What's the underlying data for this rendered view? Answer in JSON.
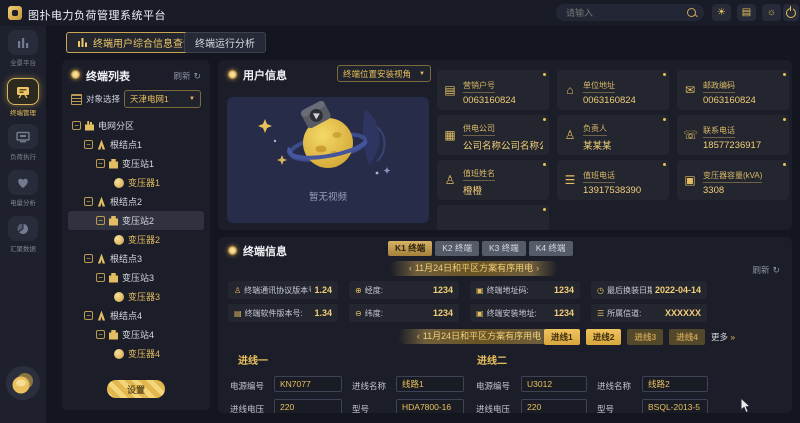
{
  "colors": {
    "accent": "#e9c05c",
    "accent_bright": "#f2cf78",
    "panel_bg": "#1b1d28",
    "card_bg": "#23252f"
  },
  "glyphs": {
    "caret": "▼",
    "collapse": "−",
    "refresh": "↻",
    "weather": "☀",
    "panels": "▤",
    "bulb": "☼",
    "more_arrow": "»",
    "banner_left": "‹",
    "banner_right": "›"
  },
  "topbar": {
    "title": "图扑电力负荷管理系统平台",
    "search_placeholder": "请输入"
  },
  "tabs": {
    "items": [
      {
        "label": "终端用户综合信息查询",
        "active": true
      },
      {
        "label": "终端运行分析",
        "active": false
      }
    ]
  },
  "sidebar": {
    "items": [
      {
        "label": "全景平台",
        "active": false
      },
      {
        "label": "终端管理",
        "active": true
      },
      {
        "label": "负荷执行",
        "active": false
      },
      {
        "label": "电量分析",
        "active": false
      },
      {
        "label": "汇聚数据",
        "active": false
      }
    ]
  },
  "terminal_list": {
    "title": "终端列表",
    "refresh_label": "刷新",
    "object_select_label": "对象选择",
    "object_select_value": "天津电网1",
    "confirm_button": "设置",
    "tree": [
      {
        "label": "电网分区",
        "level": 0
      },
      {
        "label": "根结点1",
        "level": 1
      },
      {
        "label": "变压站1",
        "level": 2
      },
      {
        "label": "变压器1",
        "level": 3
      },
      {
        "label": "根结点2",
        "level": 1
      },
      {
        "label": "变压站2",
        "level": 2,
        "selected": true
      },
      {
        "label": "变压器2",
        "level": 3
      },
      {
        "label": "根结点3",
        "level": 1
      },
      {
        "label": "变压站3",
        "level": 2
      },
      {
        "label": "变压器3",
        "level": 3
      },
      {
        "label": "根结点4",
        "level": 1
      },
      {
        "label": "变压站4",
        "level": 2
      },
      {
        "label": "变压器4",
        "level": 3
      }
    ]
  },
  "user_info": {
    "title": "用户信息",
    "view_select_value": "终端位置安装视角",
    "no_video_text": "暂无视频",
    "cards": [
      {
        "label": "营销户号",
        "value": "0063160824",
        "icon": "▤"
      },
      {
        "label": "单位地址",
        "value": "0063160824",
        "icon": "⌂"
      },
      {
        "label": "邮政编码",
        "value": "0063160824",
        "icon": "✉"
      },
      {
        "label": "供电公司",
        "value": "公司名称公司名称公",
        "icon": "▦"
      },
      {
        "label": "负责人",
        "value": "某某某",
        "icon": "♙"
      },
      {
        "label": "联系电话",
        "value": "18577236917",
        "icon": "☏"
      },
      {
        "label": "值班姓名",
        "value": "橙橙",
        "icon": "♙"
      },
      {
        "label": "值班电话",
        "value": "13917538390",
        "icon": "☰"
      },
      {
        "label": "变压器容量(kVA)",
        "value": "3308",
        "icon": "▣"
      }
    ]
  },
  "terminal_info": {
    "title": "终端信息",
    "refresh_label": "刷新",
    "k_tabs": [
      {
        "label": "K1 终端",
        "active": true
      },
      {
        "label": "K2 终端",
        "active": false
      },
      {
        "label": "K3 终端",
        "active": false
      },
      {
        "label": "K4 终端",
        "active": false
      }
    ],
    "banner": "11月24日和平区方案有序用电",
    "fields": [
      {
        "label": "终端通讯协议版本号",
        "value": "1.24",
        "icon": "♙"
      },
      {
        "label": "经度:",
        "value": "1234",
        "icon": "⊕"
      },
      {
        "label": "终端地址码:",
        "value": "1234",
        "icon": "▣"
      },
      {
        "label": "最后换装日期:",
        "value": "2022-04-14",
        "icon": "◷"
      },
      {
        "label": "终端软件版本号:",
        "value": "1.34",
        "icon": "▤"
      },
      {
        "label": "纬度:",
        "value": "1234",
        "icon": "⊖"
      },
      {
        "label": "终端安装地址:",
        "value": "1234",
        "icon": "▣"
      },
      {
        "label": "所属信道:",
        "value": "XXXXXX",
        "icon": "☰"
      }
    ],
    "line_buttons": [
      {
        "label": "进线1",
        "active": true
      },
      {
        "label": "进线2",
        "active": true
      },
      {
        "label": "进线3",
        "active": false
      },
      {
        "label": "进线4",
        "active": false
      }
    ],
    "more_label": "更多",
    "sections": [
      {
        "title": "进线一",
        "fields": [
          {
            "label": "电源编号",
            "value": "KN7077"
          },
          {
            "label": "进线名称",
            "value": "线路1"
          },
          {
            "label": "进线电压",
            "value": "220"
          },
          {
            "label": "型号",
            "value": "HDA7800-16"
          }
        ]
      },
      {
        "title": "进线二",
        "fields": [
          {
            "label": "电源编号",
            "value": "U3012"
          },
          {
            "label": "进线名称",
            "value": "线路2"
          },
          {
            "label": "进线电压",
            "value": "220"
          },
          {
            "label": "型号",
            "value": "BSQL-2013-5"
          }
        ]
      }
    ]
  }
}
